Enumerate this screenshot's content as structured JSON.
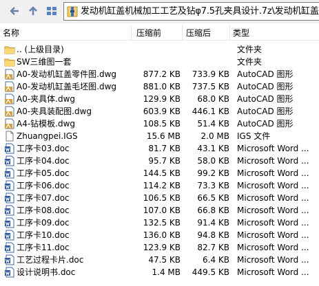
{
  "toolbar": {
    "back_icon": "back-arrow-icon",
    "up_icon": "up-arrow-icon",
    "address_icon": "archive-icon",
    "address": "发动机缸盖机械加工工艺及钻φ7.5孔夹具设计.7z\\发动机缸盖机械"
  },
  "columns": {
    "name": "名称",
    "size": "压缩前",
    "packed": "压缩后",
    "type": "类型"
  },
  "files": [
    {
      "name": ".. (上级目录)",
      "size": "",
      "packed": "",
      "type": "文件夹",
      "icon": "folder-icon"
    },
    {
      "name": "SW三维图一套",
      "size": "",
      "packed": "",
      "type": "文件夹",
      "icon": "folder-icon"
    },
    {
      "name": "A0-发动机缸盖零件图.dwg",
      "size": "877.2 KB",
      "packed": "733.9 KB",
      "type": "AutoCAD 图形",
      "icon": "dwg-icon"
    },
    {
      "name": "A0-发动机缸盖毛坯图.dwg",
      "size": "881.0 KB",
      "packed": "737.5 KB",
      "type": "AutoCAD 图形",
      "icon": "dwg-icon"
    },
    {
      "name": "A0-夹具体.dwg",
      "size": "129.9 KB",
      "packed": "68.0 KB",
      "type": "AutoCAD 图形",
      "icon": "dwg-icon"
    },
    {
      "name": "A0-夹具装配图.dwg",
      "size": "603.9 KB",
      "packed": "446.1 KB",
      "type": "AutoCAD 图形",
      "icon": "dwg-icon"
    },
    {
      "name": "A4-钻模板.dwg",
      "size": "108.5 KB",
      "packed": "51.4 KB",
      "type": "AutoCAD 图形",
      "icon": "dwg-icon"
    },
    {
      "name": "Zhuangpei.IGS",
      "size": "15.6 MB",
      "packed": "2.0 MB",
      "type": "IGS 文件",
      "icon": "file-icon"
    },
    {
      "name": "工序卡03.doc",
      "size": "81.7 KB",
      "packed": "43.1 KB",
      "type": "Microsoft Word ...",
      "icon": "word-icon"
    },
    {
      "name": "工序卡04.doc",
      "size": "95.7 KB",
      "packed": "58.0 KB",
      "type": "Microsoft Word ...",
      "icon": "word-icon"
    },
    {
      "name": "工序卡05.doc",
      "size": "144.5 KB",
      "packed": "99.2 KB",
      "type": "Microsoft Word ...",
      "icon": "word-icon"
    },
    {
      "name": "工序卡06.doc",
      "size": "114.2 KB",
      "packed": "73.3 KB",
      "type": "Microsoft Word ...",
      "icon": "word-icon"
    },
    {
      "name": "工序卡07.doc",
      "size": "106.5 KB",
      "packed": "66.5 KB",
      "type": "Microsoft Word ...",
      "icon": "word-icon"
    },
    {
      "name": "工序卡08.doc",
      "size": "107.0 KB",
      "packed": "66.8 KB",
      "type": "Microsoft Word ...",
      "icon": "word-icon"
    },
    {
      "name": "工序卡09.doc",
      "size": "132.5 KB",
      "packed": "91.4 KB",
      "type": "Microsoft Word ...",
      "icon": "word-icon"
    },
    {
      "name": "工序卡10.doc",
      "size": "136.0 KB",
      "packed": "94.8 KB",
      "type": "Microsoft Word ...",
      "icon": "word-icon"
    },
    {
      "name": "工序卡11.doc",
      "size": "123.9 KB",
      "packed": "82.7 KB",
      "type": "Microsoft Word ...",
      "icon": "word-icon"
    },
    {
      "name": "工艺过程卡片.doc",
      "size": "47.5 KB",
      "packed": "6.4 KB",
      "type": "Microsoft Word ...",
      "icon": "word-icon"
    },
    {
      "name": "设计说明书.doc",
      "size": "1.4 MB",
      "packed": "449.5 KB",
      "type": "Microsoft Word ...",
      "icon": "word-icon"
    }
  ]
}
